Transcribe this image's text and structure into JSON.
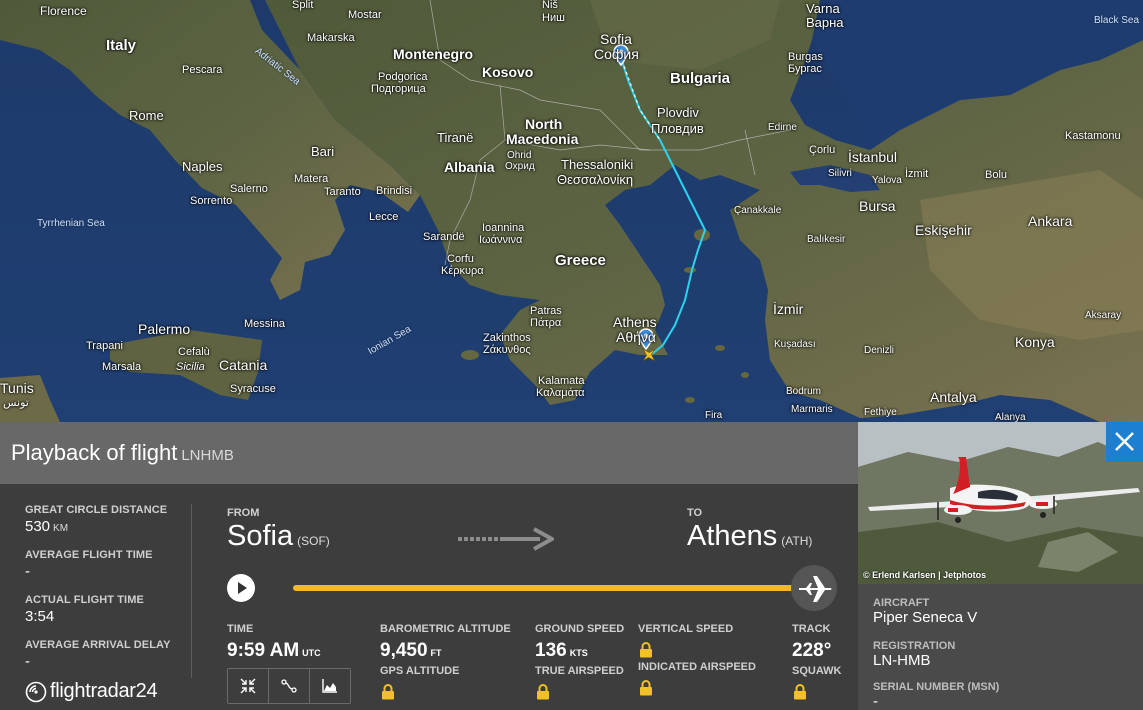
{
  "map": {
    "labels": {
      "florence": "Florence",
      "split": "Split",
      "mostar": "Mostar",
      "nis": "Niš",
      "nis_cyr": "Ниш",
      "varna": "Varna",
      "varna_cyr": "Варна",
      "black_sea": "Black Sea",
      "italy": "Italy",
      "makarska": "Makarska",
      "sofia": "Sofia",
      "sofia_cyr": "София",
      "montenegro": "Montenegro",
      "kosovo": "Kosovo",
      "burgas": "Burgas",
      "burgas_cyr": "Бургас",
      "pescara": "Pescara",
      "adriatic": "Adriatic Sea",
      "podgorica": "Podgorica",
      "podgorica_cyr": "Подгорица",
      "bulgaria": "Bulgaria",
      "rome": "Rome",
      "plovdiv": "Plovdiv",
      "plovdiv_cyr": "Пловдив",
      "edirne": "Edirne",
      "tirane": "Tiranë",
      "north": "North",
      "macedonia": "Macedonia",
      "kastamonu": "Kastamonu",
      "bari": "Bari",
      "corlu": "Çorlu",
      "istanbul": "İstanbul",
      "naples": "Naples",
      "matera": "Matera",
      "ohrid": "Ohrid",
      "ohrid_cyr": "Охрид",
      "albania": "Albania",
      "thessaloniki": "Thessaloniki",
      "thessaloniki_gr": "Θεσσαλονίκη",
      "silivri": "Silivri",
      "yalova": "Yalova",
      "izmit": "İzmit",
      "bolu": "Bolu",
      "salerno": "Salerno",
      "taranto": "Taranto",
      "brindisi": "Brindisi",
      "sorrento": "Sorrento",
      "bursa": "Bursa",
      "canakkale": "Çanakkale",
      "tyrrhenian": "Tyrrhenian Sea",
      "lecce": "Lecce",
      "ankara": "Ankara",
      "eskisehir": "Eskişehir",
      "balikesir": "Balıkesir",
      "ioannina": "Ioannina",
      "ioannina_gr": "Ιωάννινα",
      "sarande": "Sarandë",
      "greece": "Greece",
      "corfu": "Corfu",
      "corfu_gr": "Κέρκυρα",
      "izmir": "İzmir",
      "aksaray": "Aksaray",
      "palermo": "Palermo",
      "messina": "Messina",
      "patras": "Patras",
      "patras_gr": "Πάτρα",
      "athens": "Athens",
      "athens_gr": "Αθήνα",
      "ionian": "Ionian Sea",
      "konya": "Konya",
      "trapani": "Trapani",
      "cefalu": "Cefalù",
      "zakinthos": "Zakinthos",
      "zakinthos_gr": "Ζάκυνθος",
      "kusadasi": "Kuşadası",
      "denizli": "Denizli",
      "marsala": "Marsala",
      "sicilia": "Sicilia",
      "catania": "Catania",
      "tunis": "Tunis",
      "tunis_ar": "تونس",
      "syracuse": "Syracuse",
      "kalamata": "Kalamata",
      "kalamata_gr": "Καλαμάτα",
      "bodrum": "Bodrum",
      "antalya": "Antalya",
      "marmaris": "Marmaris",
      "fethiye": "Fethiye",
      "fira": "Fira",
      "alanya": "Alanya"
    }
  },
  "header": {
    "title": "Playback of flight",
    "registration": "LNHMB"
  },
  "stats": {
    "distance_label": "GREAT CIRCLE DISTANCE",
    "distance_value": "530",
    "distance_unit": "KM",
    "avg_time_label": "AVERAGE FLIGHT TIME",
    "avg_time_value": "-",
    "actual_time_label": "ACTUAL FLIGHT TIME",
    "actual_time_value": "3:54",
    "delay_label": "AVERAGE ARRIVAL DELAY",
    "delay_value": "-"
  },
  "route": {
    "from_label": "FROM",
    "from_city": "Sofia",
    "from_code": "(SOF)",
    "to_label": "TO",
    "to_city": "Athens",
    "to_code": "(ATH)"
  },
  "playback": {
    "progress": 1.0
  },
  "flight": {
    "time_label": "TIME",
    "time_value": "9:59 AM",
    "time_unit": "UTC",
    "baro_label": "BAROMETRIC ALTITUDE",
    "baro_value": "9,450",
    "baro_unit": "FT",
    "gps_label": "GPS ALTITUDE",
    "gs_label": "GROUND SPEED",
    "gs_value": "136",
    "gs_unit": "KTS",
    "tas_label": "TRUE AIRSPEED",
    "vs_label": "VERTICAL SPEED",
    "ias_label": "INDICATED AIRSPEED",
    "track_label": "TRACK",
    "track_value": "228°",
    "squawk_label": "SQUAWK"
  },
  "brand": {
    "name": "flightradar24"
  },
  "aircraft": {
    "photo_credit": "© Erlend Karlsen | Jetphotos",
    "aircraft_label": "AIRCRAFT",
    "aircraft_value": "Piper Seneca V",
    "reg_label": "REGISTRATION",
    "reg_value": "LN-HMB",
    "msn_label": "SERIAL NUMBER (MSN)",
    "msn_value": "-"
  },
  "colors": {
    "track_line": "#2ad4f0",
    "progress": "#f2b825",
    "close_button": "#1d7fd0"
  }
}
